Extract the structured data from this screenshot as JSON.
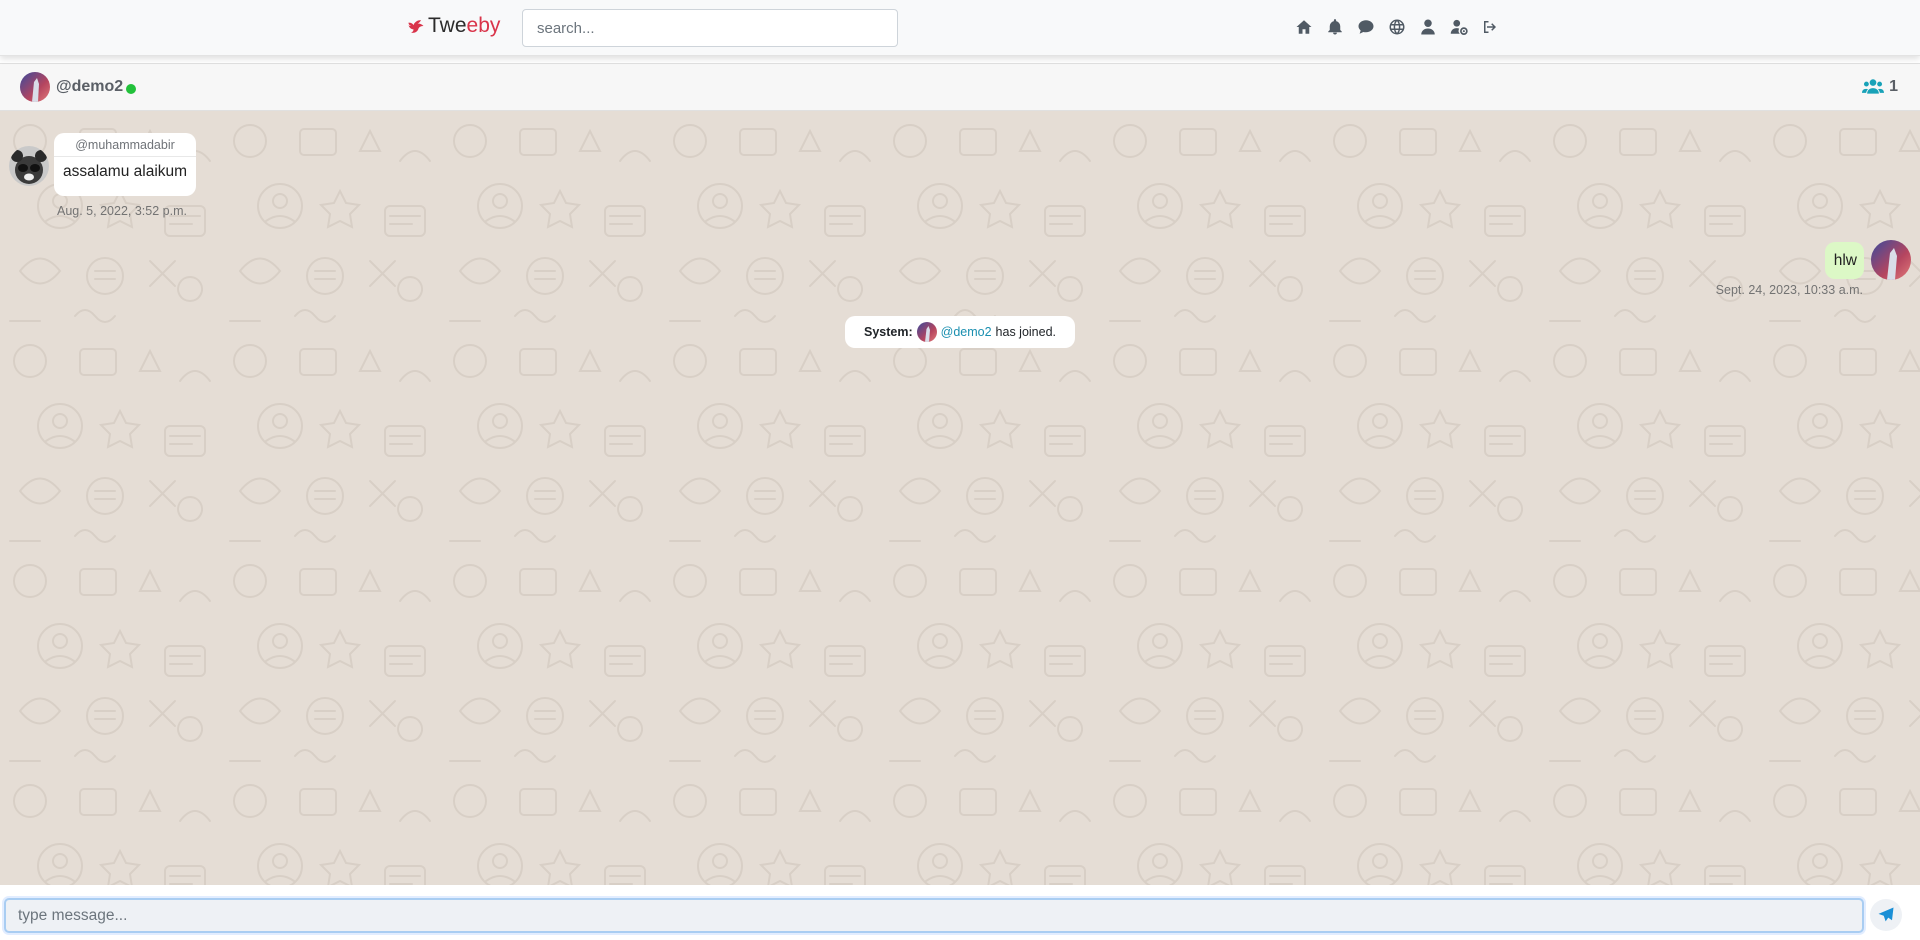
{
  "navbar": {
    "brand_part1": "Twe",
    "brand_part2": "eby",
    "search_placeholder": "search...",
    "icons": [
      "home-icon",
      "bell-icon",
      "comment-icon",
      "globe-icon",
      "user-icon",
      "user-cog-icon",
      "sign-out-icon"
    ]
  },
  "chat_header": {
    "username": "@demo2",
    "status": "online",
    "member_count": "1"
  },
  "messages": [
    {
      "direction": "incoming",
      "sender": "@muhammadabir",
      "text": "assalamu alaikum",
      "timestamp": "Aug. 5, 2022, 3:52 p.m."
    },
    {
      "direction": "outgoing",
      "text": "hlw",
      "timestamp": "Sept. 24, 2023, 10:33 a.m."
    }
  ],
  "system_message": {
    "label": "System:",
    "user": "@demo2",
    "text": "has joined."
  },
  "composer": {
    "placeholder": "type message..."
  },
  "colors": {
    "chat_background": "#e5ddd5",
    "outgoing_bubble": "#dcf8c6",
    "brand_accent": "#d9344a",
    "online": "#22c13b",
    "members_icon": "#18a2b8"
  }
}
